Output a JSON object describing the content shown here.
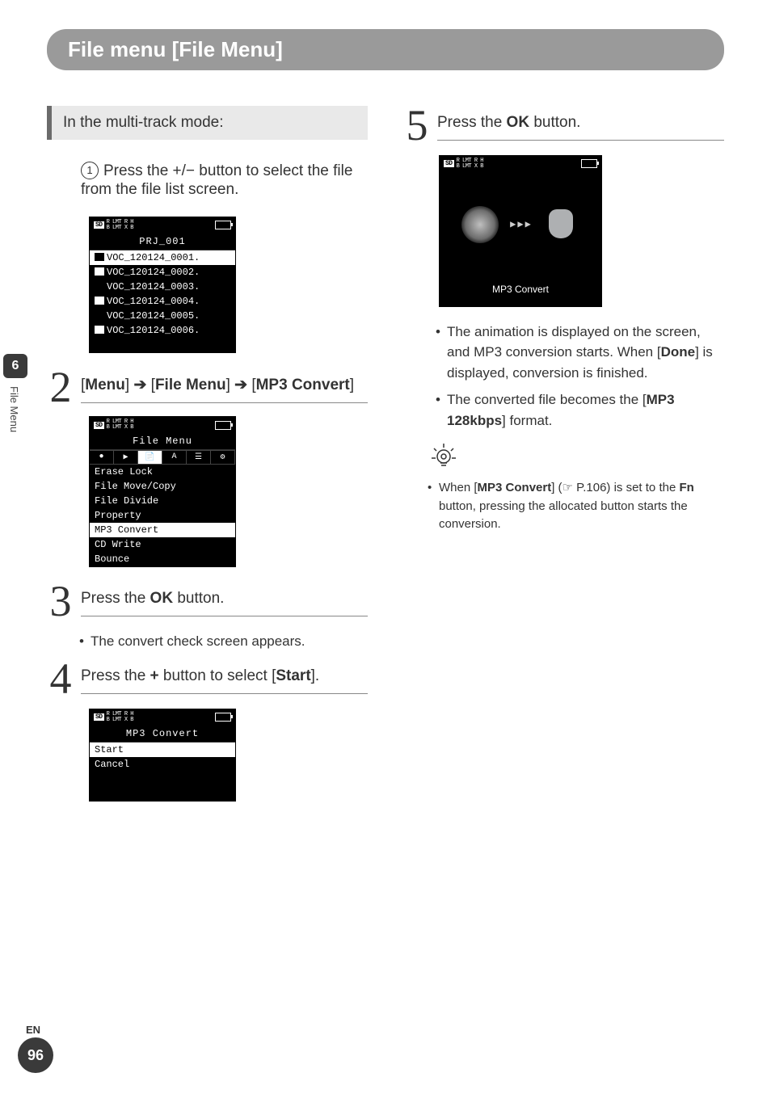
{
  "title": "File menu [File Menu]",
  "side": {
    "chapter": "6",
    "label": "File Menu"
  },
  "footer": {
    "lang": "EN",
    "page": "96"
  },
  "left": {
    "callout": "In the multi-track mode:",
    "step1": {
      "circled": "1",
      "text_a": "Press the ",
      "btn": "+/−",
      "text_b": " button to select the file from the file list screen."
    },
    "screen1": {
      "sd": "SD",
      "status": "R LMT  R H\nB LMT  X B H",
      "title": "PRJ_001",
      "rows": [
        "VOC_120124_0001.",
        "VOC_120124_0002.",
        "VOC_120124_0003.",
        "VOC_120124_0004.",
        "VOC_120124_0005.",
        "VOC_120124_0006."
      ],
      "sel": 0,
      "icons": [
        true,
        true,
        false,
        true,
        false,
        true
      ]
    },
    "step2": {
      "num": "2",
      "a": "Menu",
      "arrow": "➔",
      "b": "File Menu",
      "c": "MP3 Convert"
    },
    "screen2": {
      "title": "File Menu",
      "tabs": [
        "🎙",
        "▶",
        "📁",
        "A",
        "☰",
        "⚙"
      ],
      "active_tab": 2,
      "rows": [
        "Erase Lock",
        "File Move/Copy",
        "File Divide",
        "Property",
        "MP3 Convert",
        "CD Write",
        "Bounce"
      ],
      "sel": 4
    },
    "step3": {
      "num": "3",
      "a": "Press the ",
      "btn": "OK",
      "b": " button."
    },
    "step3_bullet": "The convert check screen appears.",
    "step4": {
      "num": "4",
      "a": "Press the ",
      "btn": "+",
      "b": " button to select [",
      "opt": "Start",
      "c": "]."
    },
    "screen4": {
      "title": "MP3 Convert",
      "rows": [
        "Start",
        "Cancel"
      ],
      "sel": 0
    }
  },
  "right": {
    "step5": {
      "num": "5",
      "a": "Press the ",
      "btn": "OK",
      "b": " button."
    },
    "screen5": {
      "caption": "MP3 Convert"
    },
    "bullets": [
      {
        "a": "The animation is displayed on the screen, and MP3 conversion starts. When [",
        "b": "Done",
        "c": "] is displayed, conversion is finished."
      },
      {
        "a": "The converted file becomes the [",
        "b": "MP3 128kbps",
        "c": "] format."
      }
    ],
    "tip": {
      "a": "When [",
      "b": "MP3 Convert",
      "c": "] (☞ P.106) is set to the ",
      "d": "Fn",
      "e": " button, pressing the allocated button starts the conversion."
    }
  }
}
